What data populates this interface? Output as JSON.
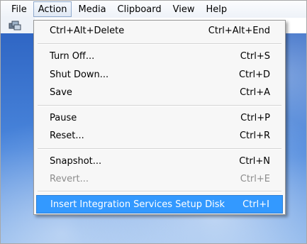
{
  "menubar": {
    "items": [
      "File",
      "Action",
      "Media",
      "Clipboard",
      "View",
      "Help"
    ],
    "active": "Action"
  },
  "toolbar": {
    "icon": "ctrl-alt-del-icon"
  },
  "action_menu": {
    "items": [
      {
        "label": "Ctrl+Alt+Delete",
        "shortcut": "Ctrl+Alt+End",
        "enabled": true
      },
      {
        "label": "Turn Off...",
        "shortcut": "Ctrl+S",
        "enabled": true
      },
      {
        "label": "Shut Down...",
        "shortcut": "Ctrl+D",
        "enabled": true
      },
      {
        "label": "Save",
        "shortcut": "Ctrl+A",
        "enabled": true
      },
      {
        "label": "Pause",
        "shortcut": "Ctrl+P",
        "enabled": true
      },
      {
        "label": "Reset...",
        "shortcut": "Ctrl+R",
        "enabled": true
      },
      {
        "label": "Snapshot...",
        "shortcut": "Ctrl+N",
        "enabled": true
      },
      {
        "label": "Revert...",
        "shortcut": "Ctrl+E",
        "enabled": false
      },
      {
        "label": "Insert Integration Services Setup Disk",
        "shortcut": "Ctrl+I",
        "enabled": true,
        "highlighted": true
      }
    ]
  },
  "colors": {
    "highlight": "#3399ff",
    "menu_background": "#f7f7f7",
    "disabled_text": "#8c8c8c"
  }
}
